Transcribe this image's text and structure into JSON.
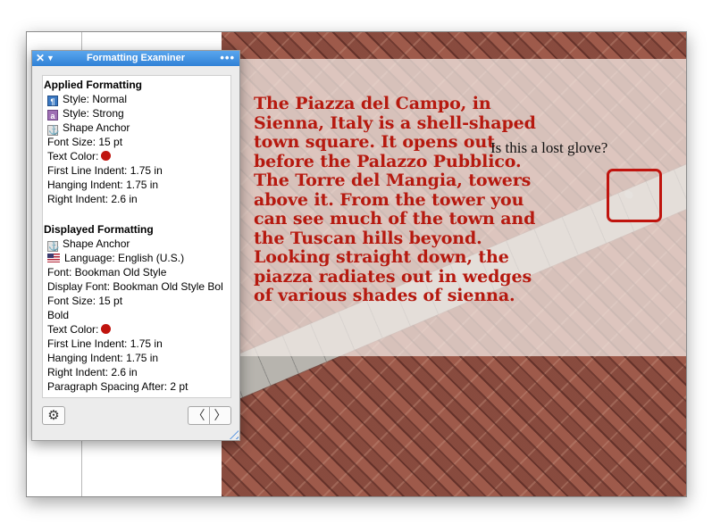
{
  "document": {
    "passage": "The Piazza del Campo, in Sienna, Italy is a shell-shaped town square. It opens out before the Palazzo Pubblico. The Torre del Mangia, towers above it. From the tower you can see much of the town and the Tuscan hills beyond. Looking straight down, the piazza radiates out in wedges of various shades of sienna.",
    "caption": "Is this a lost glove?"
  },
  "examiner": {
    "title": "Formatting Examiner",
    "close_glyph": "✕",
    "collapse_glyph": "▼",
    "more_glyph": "•••",
    "applied_heading": "Applied Formatting",
    "applied": {
      "style_normal": "Style: Normal",
      "style_strong": "Style: Strong",
      "shape_anchor": "Shape Anchor",
      "font_size": "Font Size: 15 pt",
      "text_color": "Text Color:",
      "first_line_indent": "First Line Indent: 1.75 in",
      "hanging_indent": "Hanging Indent: 1.75 in",
      "right_indent": "Right Indent: 2.6 in"
    },
    "displayed_heading": "Displayed Formatting",
    "displayed": {
      "shape_anchor": "Shape Anchor",
      "language": "Language: English (U.S.)",
      "font": "Font: Bookman Old Style",
      "display_font": "Display Font: Bookman Old Style Bol",
      "font_size": "Font Size: 15 pt",
      "bold": "Bold",
      "text_color": "Text Color:",
      "first_line_indent": "First Line Indent: 1.75 in",
      "hanging_indent": "Hanging Indent: 1.75 in",
      "right_indent": "Right Indent: 2.6 in",
      "paragraph_spacing": "Paragraph Spacing After: 2 pt"
    },
    "gear_glyph": "⚙",
    "prev_glyph": "〈",
    "next_glyph": "〉",
    "icons": {
      "para_style": "paragraph-style-icon",
      "char_style": "character-style-icon",
      "anchor": "anchor-icon",
      "flag": "us-flag-icon"
    },
    "text_color_value": "#c0140e"
  },
  "colors": {
    "title_bar": "#3a8de0",
    "text_red": "#b6190f",
    "annotation_box": "#c0140e"
  }
}
